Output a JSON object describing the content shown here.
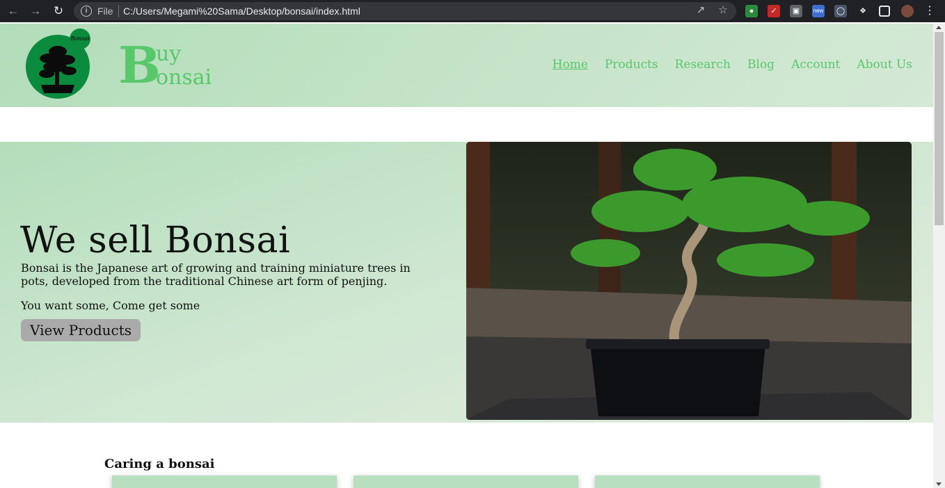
{
  "browser": {
    "file_label": "File",
    "url": "C:/Users/Megami%20Sama/Desktop/bonsai/index.html",
    "ext_badge": "new"
  },
  "header": {
    "logo_badge": "Bonsai",
    "brand_initial": "B",
    "brand_top": "uy",
    "brand_bottom": "onsai",
    "nav": [
      "Home",
      "Products",
      "Research",
      "Blog",
      "Account",
      "About Us"
    ]
  },
  "hero": {
    "title": "We sell Bonsai",
    "description": "Bonsai is the Japanese art of growing and training miniature trees in pots, developed from the traditional Chinese art form of penjing.",
    "tagline": "You want some, Come get some",
    "button": "View Products"
  },
  "section": {
    "title": "Caring a bonsai"
  },
  "colors": {
    "brand_green": "#58c86a",
    "logo_green": "#0a8b3e",
    "header_bg": "#b2ddb9"
  }
}
